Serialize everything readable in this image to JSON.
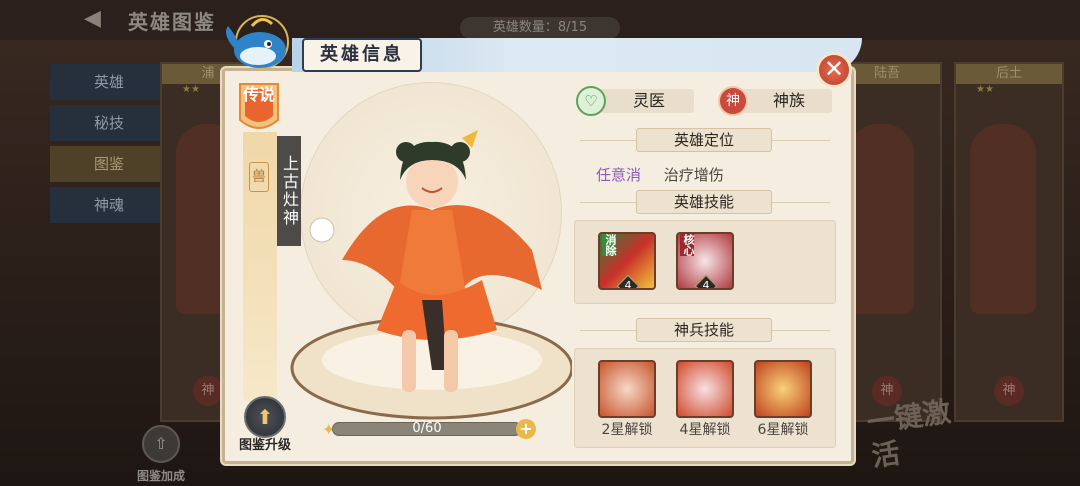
{
  "background": {
    "title": "英雄图鉴",
    "hero_count": "英雄数量：8/15",
    "side_tabs": [
      "英雄",
      "秘技",
      "图鉴",
      "神魂"
    ],
    "codex_bonus": "图鉴加成",
    "card_names": [
      "浦",
      "陆吾",
      "后土"
    ],
    "card_seal": "神",
    "one_key_activate": "一键激活"
  },
  "modal": {
    "title": "英雄信息",
    "close_symbol": "✕",
    "rarity_badge": "传说",
    "faction_icon_text": "兽",
    "hero_name": "上古灶神",
    "upgrade_label": "图鉴升级",
    "progress": {
      "text": "0/60",
      "current": 0,
      "max": 60
    },
    "class": {
      "icon": "heart-icon",
      "label": "灵医"
    },
    "race": {
      "icon_text": "神",
      "label": "神族"
    },
    "positioning": {
      "title": "英雄定位",
      "tags": [
        "任意消",
        "治疗增伤"
      ]
    },
    "hero_skills": {
      "title": "英雄技能",
      "skills": [
        {
          "tag": "消除",
          "level": "4",
          "icon": "gold-ingot-icon"
        },
        {
          "tag": "核心",
          "level": "4",
          "icon": "steamed-bun-icon"
        }
      ]
    },
    "weapon_skills": {
      "title": "神兵技能",
      "skills": [
        {
          "unlock": "2星解锁",
          "icon": "bun-pair-icon"
        },
        {
          "unlock": "4星解锁",
          "icon": "bun-sprout-icon"
        },
        {
          "unlock": "6星解锁",
          "icon": "golden-feather-icon"
        }
      ]
    },
    "colors": {
      "accent_gold": "#e2b24a",
      "close_red": "#c9473a",
      "banner_blue": "#b8d2e6"
    }
  }
}
